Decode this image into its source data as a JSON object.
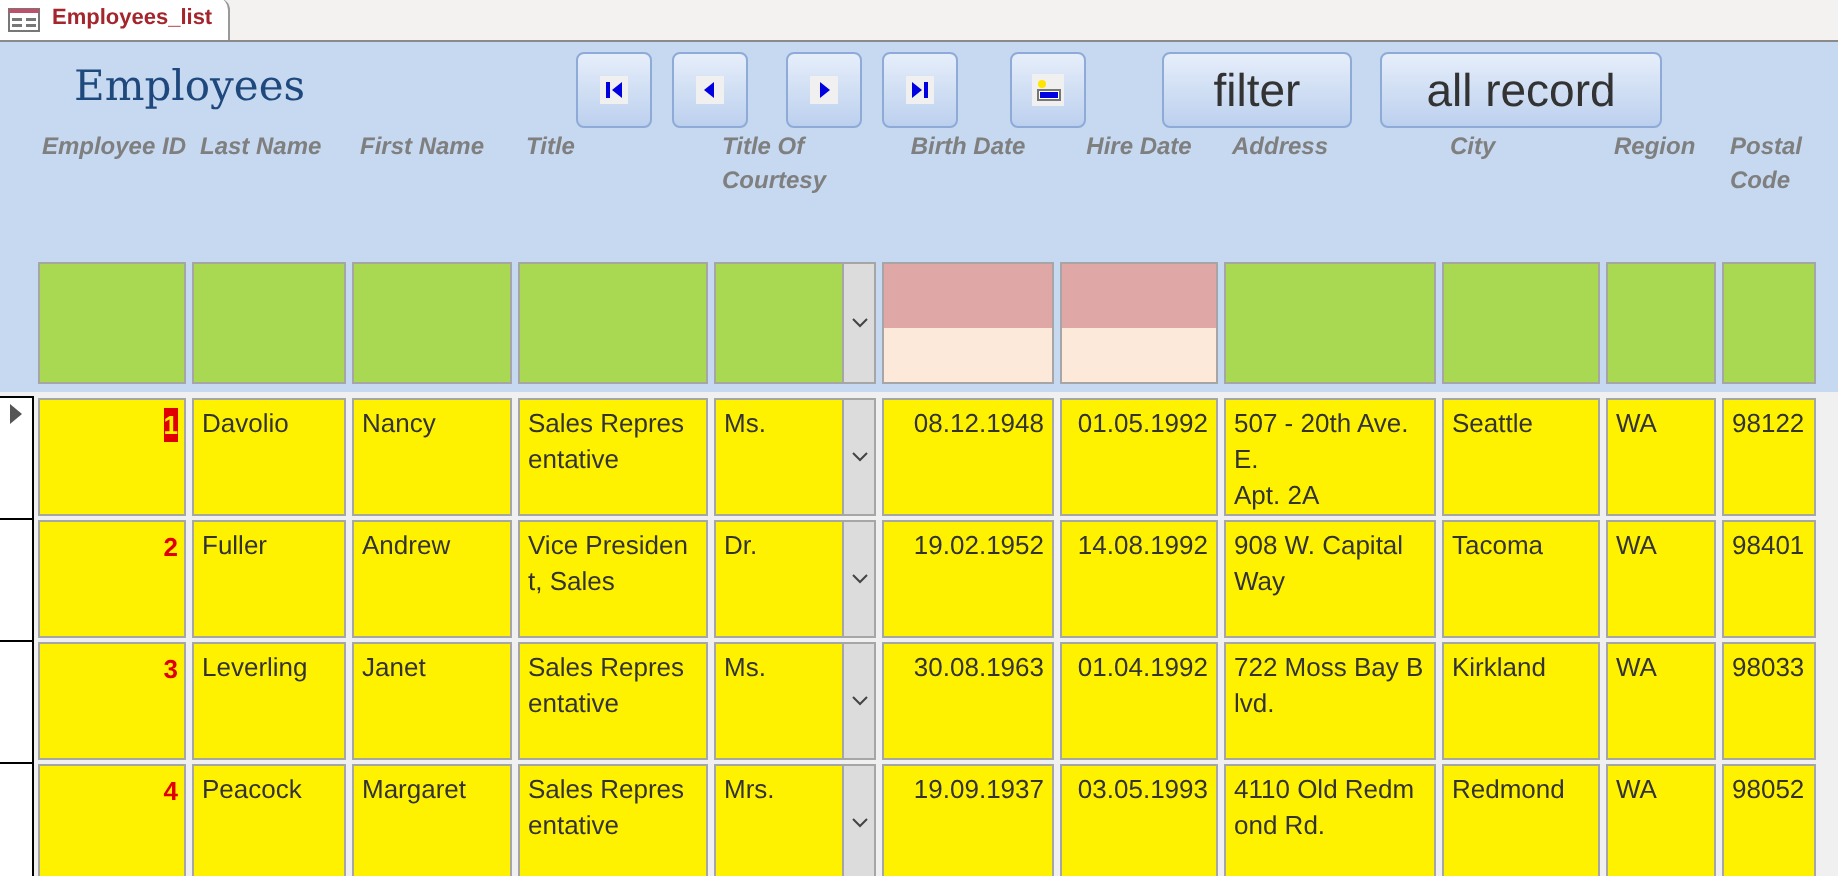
{
  "tab": {
    "title": "Employees_list"
  },
  "form": {
    "title": "Employees"
  },
  "nav_buttons": [
    {
      "kind": "first"
    },
    {
      "kind": "prev"
    },
    {
      "kind": "next"
    },
    {
      "kind": "last"
    },
    {
      "kind": "new"
    }
  ],
  "buttons": [
    "filter",
    "all record"
  ],
  "columns": [
    {
      "label": "Employee ID",
      "kind": "id"
    },
    {
      "label": "Last Name",
      "kind": "text"
    },
    {
      "label": "First Name",
      "kind": "text"
    },
    {
      "label": "Title",
      "kind": "text"
    },
    {
      "label": "Title Of Courtesy",
      "kind": "combo"
    },
    {
      "label": "Birth Date",
      "kind": "date"
    },
    {
      "label": "Hire Date",
      "kind": "date"
    },
    {
      "label": "Address",
      "kind": "text"
    },
    {
      "label": "City",
      "kind": "text"
    },
    {
      "label": "Region",
      "kind": "text"
    },
    {
      "label": "Postal Code",
      "kind": "text"
    }
  ],
  "rows": [
    {
      "current": true,
      "selected": true,
      "cells": [
        "1",
        "Davolio",
        "Nancy",
        "Sales Representative",
        "Ms.",
        "08.12.1948",
        "01.05.1992",
        "507 - 20th Ave. E.\nApt. 2A",
        "Seattle",
        "WA",
        "98122"
      ]
    },
    {
      "current": false,
      "selected": false,
      "cells": [
        "2",
        "Fuller",
        "Andrew",
        "Vice President, Sales",
        "Dr.",
        "19.02.1952",
        "14.08.1992",
        "908 W. Capital Way",
        "Tacoma",
        "WA",
        "98401"
      ]
    },
    {
      "current": false,
      "selected": false,
      "cells": [
        "3",
        "Leverling",
        "Janet",
        "Sales Representative",
        "Ms.",
        "30.08.1963",
        "01.04.1992",
        "722 Moss Bay Blvd.",
        "Kirkland",
        "WA",
        "98033"
      ]
    },
    {
      "current": false,
      "selected": false,
      "cells": [
        "4",
        "Peacock",
        "Margaret",
        "Sales Representative",
        "Mrs.",
        "19.09.1937",
        "03.05.1993",
        "4110 Old Redmond Rd.",
        "Redmond",
        "WA",
        "98052"
      ]
    }
  ]
}
